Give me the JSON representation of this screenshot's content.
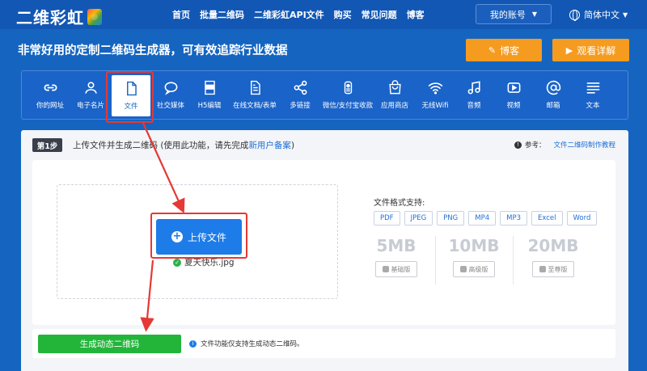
{
  "header": {
    "logo_text": "二维彩虹",
    "nav": [
      "首页",
      "批量二维码",
      "二维彩虹API文件",
      "购买",
      "常见问题",
      "博客"
    ],
    "account_label": "我的账号",
    "language_label": "简体中文"
  },
  "hero": {
    "title": "非常好用的定制二维码生成器，可有效追踪行业数据",
    "blog_label": "博客",
    "video_label": "观看详解"
  },
  "categories": [
    {
      "label": "你的网址",
      "icon": "link-icon"
    },
    {
      "label": "电子名片",
      "icon": "person-icon"
    },
    {
      "label": "文件",
      "icon": "file-icon",
      "active": true
    },
    {
      "label": "社交媒体",
      "icon": "chat-bubble-icon"
    },
    {
      "label": "H5编辑",
      "icon": "html-icon"
    },
    {
      "label": "在线文档/表单",
      "icon": "document-icon"
    },
    {
      "label": "多链接",
      "icon": "share-icon"
    },
    {
      "label": "微信/支付宝收款",
      "icon": "wallet-icon"
    },
    {
      "label": "应用商店",
      "icon": "store-bag-icon"
    },
    {
      "label": "无线Wifi",
      "icon": "wifi-icon"
    },
    {
      "label": "音频",
      "icon": "music-note-icon"
    },
    {
      "label": "视频",
      "icon": "video-play-icon"
    },
    {
      "label": "邮箱",
      "icon": "at-sign-icon"
    },
    {
      "label": "文本",
      "icon": "text-lines-icon"
    }
  ],
  "step": {
    "badge": "第1步",
    "text_prefix": "上传文件并生成二维码 (使用此功能，请先完成",
    "text_link": "新用户备案",
    "text_suffix": ")",
    "ref_label": "参考：",
    "ref_link": "文件二维码制作教程"
  },
  "upload": {
    "button_label": "上传文件",
    "file_name": "夏天快乐.jpg"
  },
  "formats": {
    "title": "文件格式支持:",
    "list": [
      "PDF",
      "JPEG",
      "PNG",
      "MP4",
      "MP3",
      "Excel",
      "Word"
    ]
  },
  "tiers": [
    {
      "size": "5MB",
      "plan": "基础版"
    },
    {
      "size": "10MB",
      "plan": "高级版"
    },
    {
      "size": "20MB",
      "plan": "至尊版"
    }
  ],
  "generate": {
    "button_label": "生成动态二维码",
    "note": "文件功能仅支持生成动态二维码。"
  },
  "colors": {
    "brand_blue": "#1565c0",
    "orange": "#f59b1f",
    "green": "#22b53a",
    "highlight_red": "#e53935"
  }
}
